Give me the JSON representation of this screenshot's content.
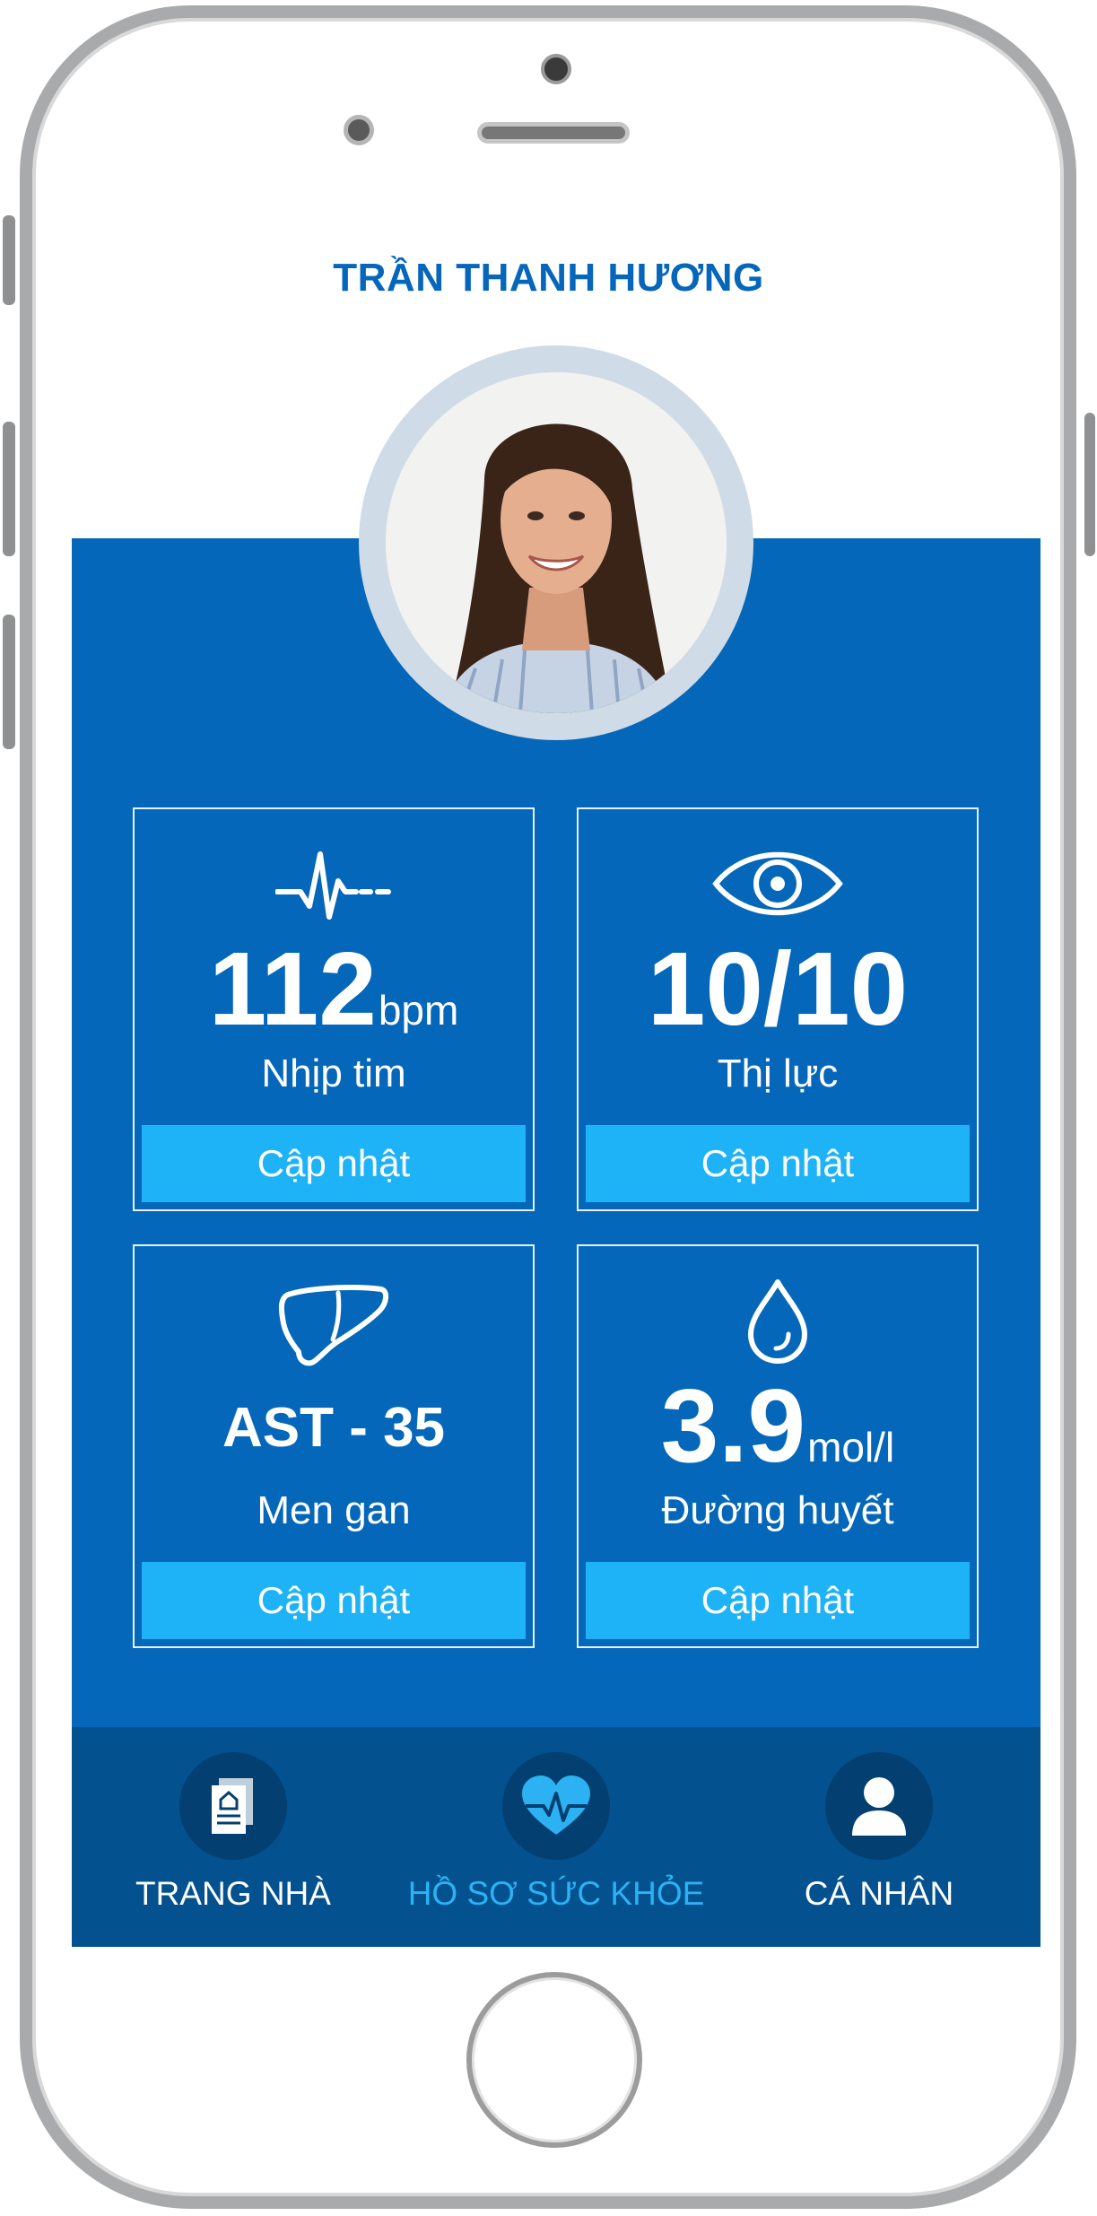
{
  "user": {
    "name": "TRẦN THANH HƯƠNG"
  },
  "cards": [
    {
      "value": "112",
      "unit": "bpm",
      "label": "Nhịp tim",
      "button": "Cập nhật",
      "icon": "heartbeat-icon"
    },
    {
      "value": "10/10",
      "unit": "",
      "label": "Thị lực",
      "button": "Cập nhật",
      "icon": "eye-icon"
    },
    {
      "value": "AST - 35",
      "unit": "",
      "label": "Men gan",
      "button": "Cập nhật",
      "icon": "liver-icon"
    },
    {
      "value": "3.9",
      "unit": "mol/l",
      "label": "Đường huyết",
      "button": "Cập nhật",
      "icon": "blood-drop-icon"
    }
  ],
  "nav": [
    {
      "label": "TRANG NHÀ",
      "icon": "home-document-icon",
      "active": false
    },
    {
      "label": "HỒ SƠ SỨC KHỎE",
      "icon": "heart-pulse-icon",
      "active": true
    },
    {
      "label": "CÁ NHÂN",
      "icon": "user-icon",
      "active": false
    }
  ],
  "colors": {
    "primary": "#0567ba",
    "accent": "#1eb3f6",
    "nav": "#03518f",
    "title": "#0566bb"
  }
}
